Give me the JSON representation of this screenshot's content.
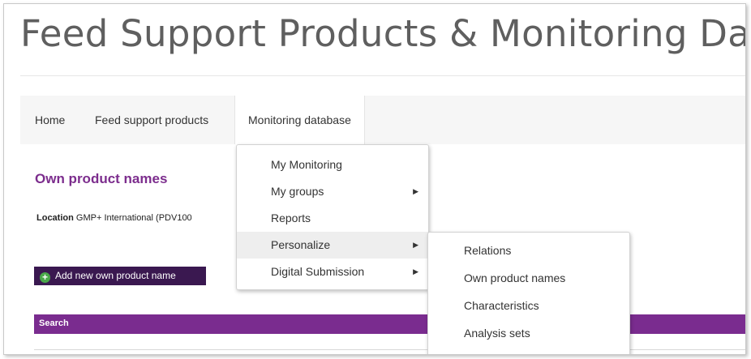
{
  "header": {
    "title": "Feed Support Products & Monitoring Database"
  },
  "nav": {
    "items": [
      {
        "label": "Home"
      },
      {
        "label": "Feed support products"
      },
      {
        "label": "Monitoring database"
      }
    ]
  },
  "page": {
    "heading": "Own product names",
    "location_label": "Location",
    "location_value": "GMP+ International (PDV100",
    "add_button_label": "Add new own product name",
    "search_label": "Search"
  },
  "dropdown": {
    "items": [
      {
        "label": "My Monitoring",
        "has_submenu": false
      },
      {
        "label": "My groups",
        "has_submenu": true
      },
      {
        "label": "Reports",
        "has_submenu": false
      },
      {
        "label": "Personalize",
        "has_submenu": true
      },
      {
        "label": "Digital Submission",
        "has_submenu": true
      }
    ],
    "caret_glyph": "▶"
  },
  "submenu": {
    "items": [
      {
        "label": "Relations"
      },
      {
        "label": "Own product names"
      },
      {
        "label": "Characteristics"
      },
      {
        "label": "Analysis sets"
      }
    ]
  },
  "colors": {
    "accent_purple": "#7a2c8f",
    "heading_purple": "#7c2d8d",
    "button_dark": "#3a1850",
    "plus_green": "#4aa84a"
  }
}
